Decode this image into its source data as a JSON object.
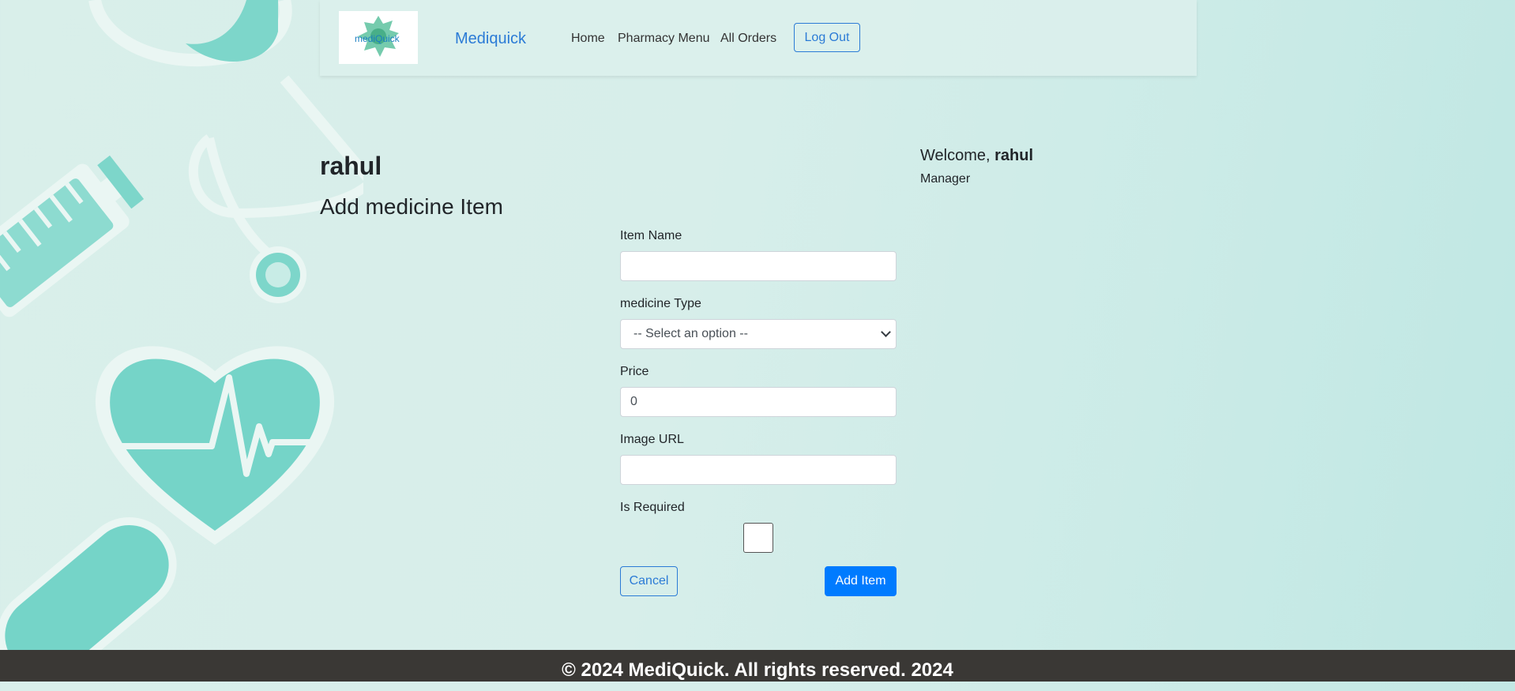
{
  "navbar": {
    "logo_text": "mediQuick",
    "brand": "Mediquick",
    "links": [
      {
        "label": "Home"
      },
      {
        "label": "Pharmacy Menu"
      },
      {
        "label": "All Orders"
      }
    ],
    "logout_label": "Log Out"
  },
  "user": {
    "name": "rahul",
    "welcome_prefix": "Welcome, ",
    "welcome_name": "rahul",
    "role": "Manager"
  },
  "page": {
    "title": "Add medicine Item"
  },
  "form": {
    "item_name": {
      "label": "Item Name",
      "value": ""
    },
    "medicine_type": {
      "label": "medicine Type",
      "selected": "-- Select an option --"
    },
    "price": {
      "label": "Price",
      "value": "0"
    },
    "image_url": {
      "label": "Image URL",
      "value": ""
    },
    "is_required": {
      "label": "Is Required",
      "checked": false
    },
    "cancel_label": "Cancel",
    "submit_label": "Add Item"
  },
  "footer": {
    "text": "© 2024 MediQuick. All rights reserved. 2024"
  },
  "colors": {
    "accent": "#007bff",
    "brand": "#2b7bd6",
    "art_teal": "#75d4c8",
    "footer_bg": "#3a3835"
  }
}
